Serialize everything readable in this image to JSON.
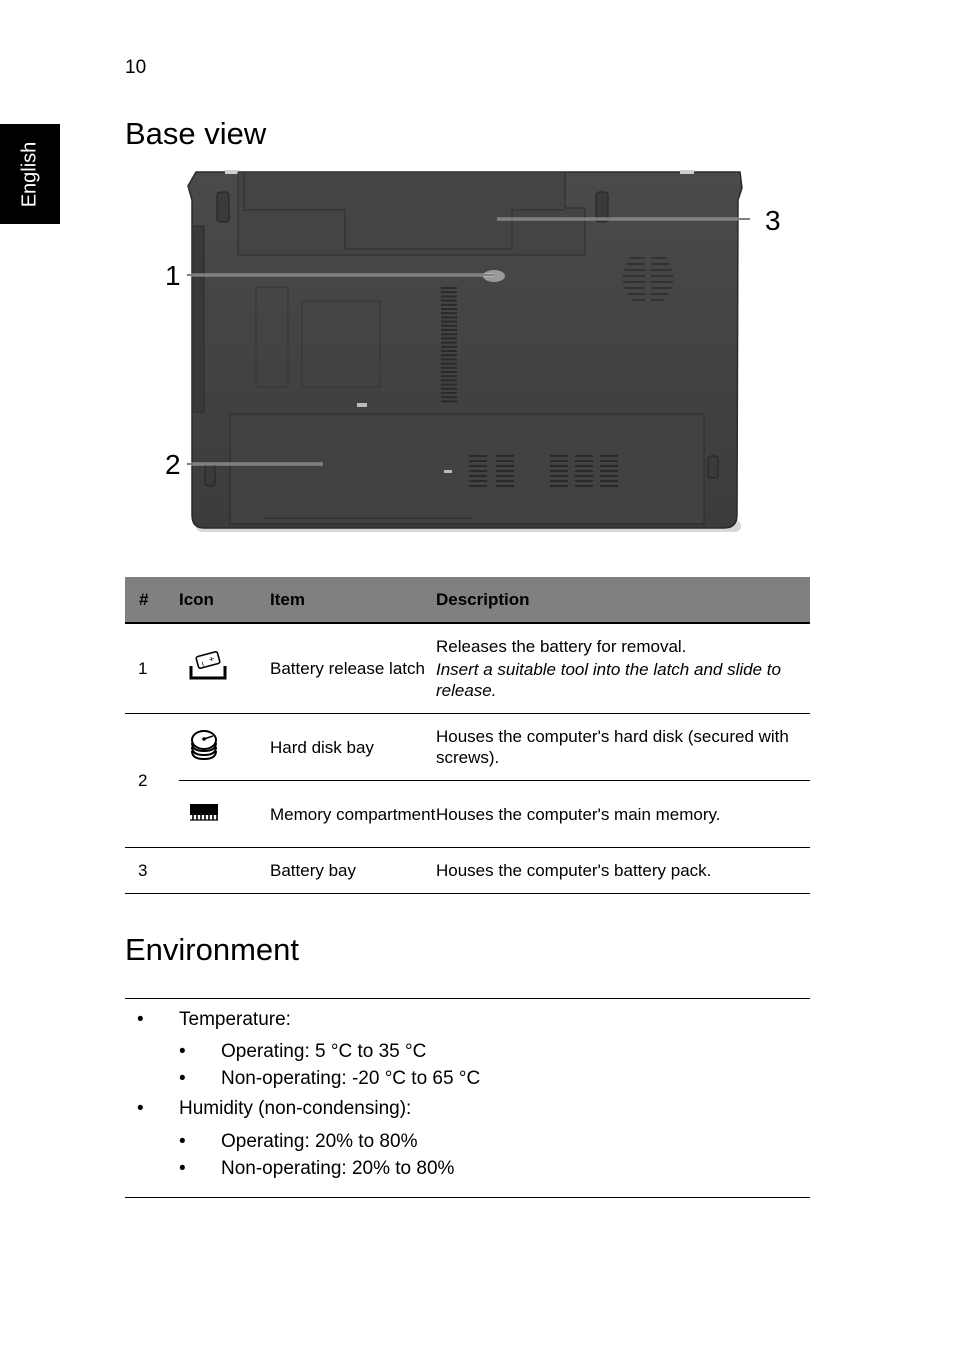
{
  "page": {
    "number": "10",
    "language_tab": "English"
  },
  "base_view": {
    "title": "Base view",
    "figure": {
      "description": "Underside of laptop with numbered callouts",
      "callouts": [
        "1",
        "2",
        "3"
      ]
    },
    "table": {
      "headers": [
        "#",
        "Icon",
        "Item",
        "Description"
      ],
      "header_bg": "#808080",
      "rows": [
        {
          "num": "1",
          "icon": "battery-release-icon",
          "item": "Battery release latch",
          "description": "Releases the battery for removal.",
          "note": "Insert a suitable tool into the latch and slide to release."
        },
        {
          "num": "2",
          "icon": "hard-disk-icon",
          "item": "Hard disk bay",
          "description": "Houses the computer's hard disk (secured with screws)."
        },
        {
          "num": "",
          "icon": "memory-icon",
          "item": "Memory compartment",
          "description": "Houses the computer's main memory."
        },
        {
          "num": "3",
          "icon": "",
          "item": "Battery bay",
          "description": "Houses the computer's battery pack."
        }
      ]
    }
  },
  "environment": {
    "title": "Environment",
    "items": [
      {
        "label": "Temperature:",
        "sub": [
          "Operating: 5 °C to 35 °C",
          "Non-operating: -20 °C to 65 °C"
        ]
      },
      {
        "label": "Humidity (non-condensing):",
        "sub": [
          "Operating: 20% to 80%",
          "Non-operating: 20% to 80%"
        ]
      }
    ],
    "bullet": "•"
  }
}
